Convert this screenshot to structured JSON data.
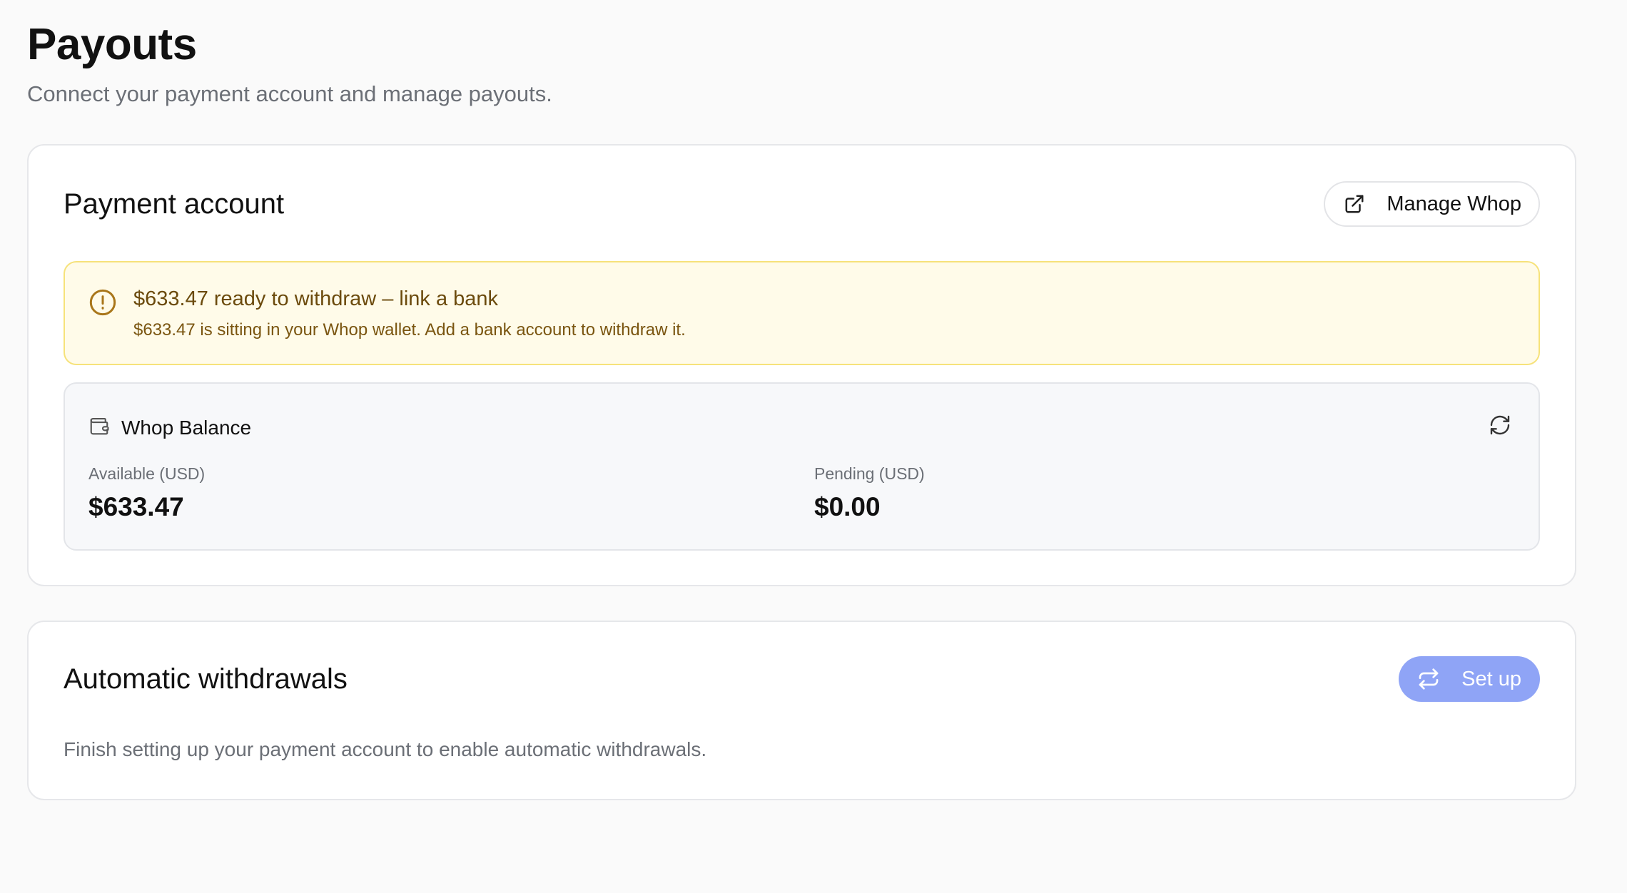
{
  "page": {
    "title": "Payouts",
    "subtitle": "Connect your payment account and manage payouts."
  },
  "payment_account": {
    "title": "Payment account",
    "manage_button": {
      "label": "Manage Whop",
      "icon": "external-link-icon"
    },
    "alert": {
      "icon": "alert-circle-icon",
      "title": "$633.47 ready to withdraw – link a bank",
      "text": "$633.47 is sitting in your Whop wallet. Add a bank account to withdraw it."
    },
    "balance": {
      "icon": "wallet-icon",
      "title": "Whop Balance",
      "refresh_icon": "refresh-icon",
      "available_label": "Available (USD)",
      "available_value": "$633.47",
      "pending_label": "Pending (USD)",
      "pending_value": "$0.00"
    }
  },
  "automatic_withdrawals": {
    "title": "Automatic withdrawals",
    "setup_button": {
      "label": "Set up",
      "icon": "repeat-icon"
    },
    "description": "Finish setting up your payment account to enable automatic withdrawals."
  },
  "colors": {
    "page_background": "#fafafa",
    "card_background": "#ffffff",
    "alert_background": "#fffbe9",
    "alert_border": "#f6e27a",
    "alert_text": "#6b4a0c",
    "primary_button": "#8fa4f6",
    "muted_text": "#6b6f76"
  }
}
